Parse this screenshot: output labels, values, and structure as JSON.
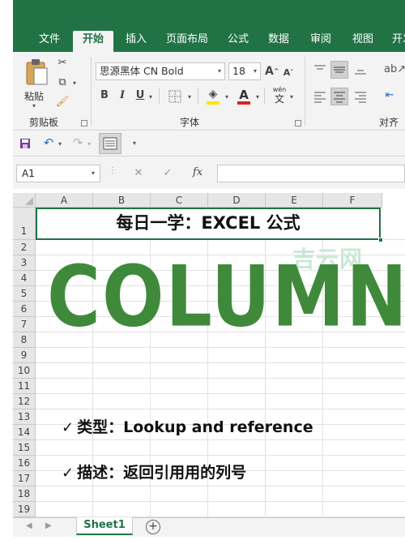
{
  "tabs": [
    "文件",
    "开始",
    "插入",
    "页面布局",
    "公式",
    "数据",
    "审阅",
    "视图",
    "开发"
  ],
  "ribbon": {
    "clipboard": {
      "paste_label": "粘贴",
      "group_label": "剪贴板"
    },
    "font": {
      "family": "思源黑体 CN Bold",
      "size": "18",
      "bold": "B",
      "italic": "I",
      "underline": "U",
      "color_letter": "A",
      "phonetic_top": "wén",
      "phonetic_bottom": "文",
      "grow": "A",
      "shrink": "A",
      "group_label": "字体"
    },
    "alignment": {
      "group_label": "对齐"
    }
  },
  "formula_bar": {
    "cell_ref": "A1",
    "fx": "fx",
    "value": ""
  },
  "columns": [
    "A",
    "B",
    "C",
    "D",
    "E",
    "F"
  ],
  "rows": [
    "1",
    "2",
    "3",
    "4",
    "5",
    "6",
    "7",
    "8",
    "9",
    "10",
    "11",
    "12",
    "13",
    "14",
    "15",
    "16",
    "17",
    "18",
    "19"
  ],
  "cells": {
    "a1": "每日一学：EXCEL 公式",
    "headline": "COLUMN",
    "line1_check": "✓",
    "line1": "类型：Lookup and reference",
    "line2_check": "✓",
    "line2": "描述：返回引用用的列号"
  },
  "watermark": "吉云网",
  "sheet_tab": "Sheet1",
  "colors": {
    "excel_green": "#217346",
    "headline_green": "#3f8a3a",
    "watermark": "#c9e8d5"
  }
}
